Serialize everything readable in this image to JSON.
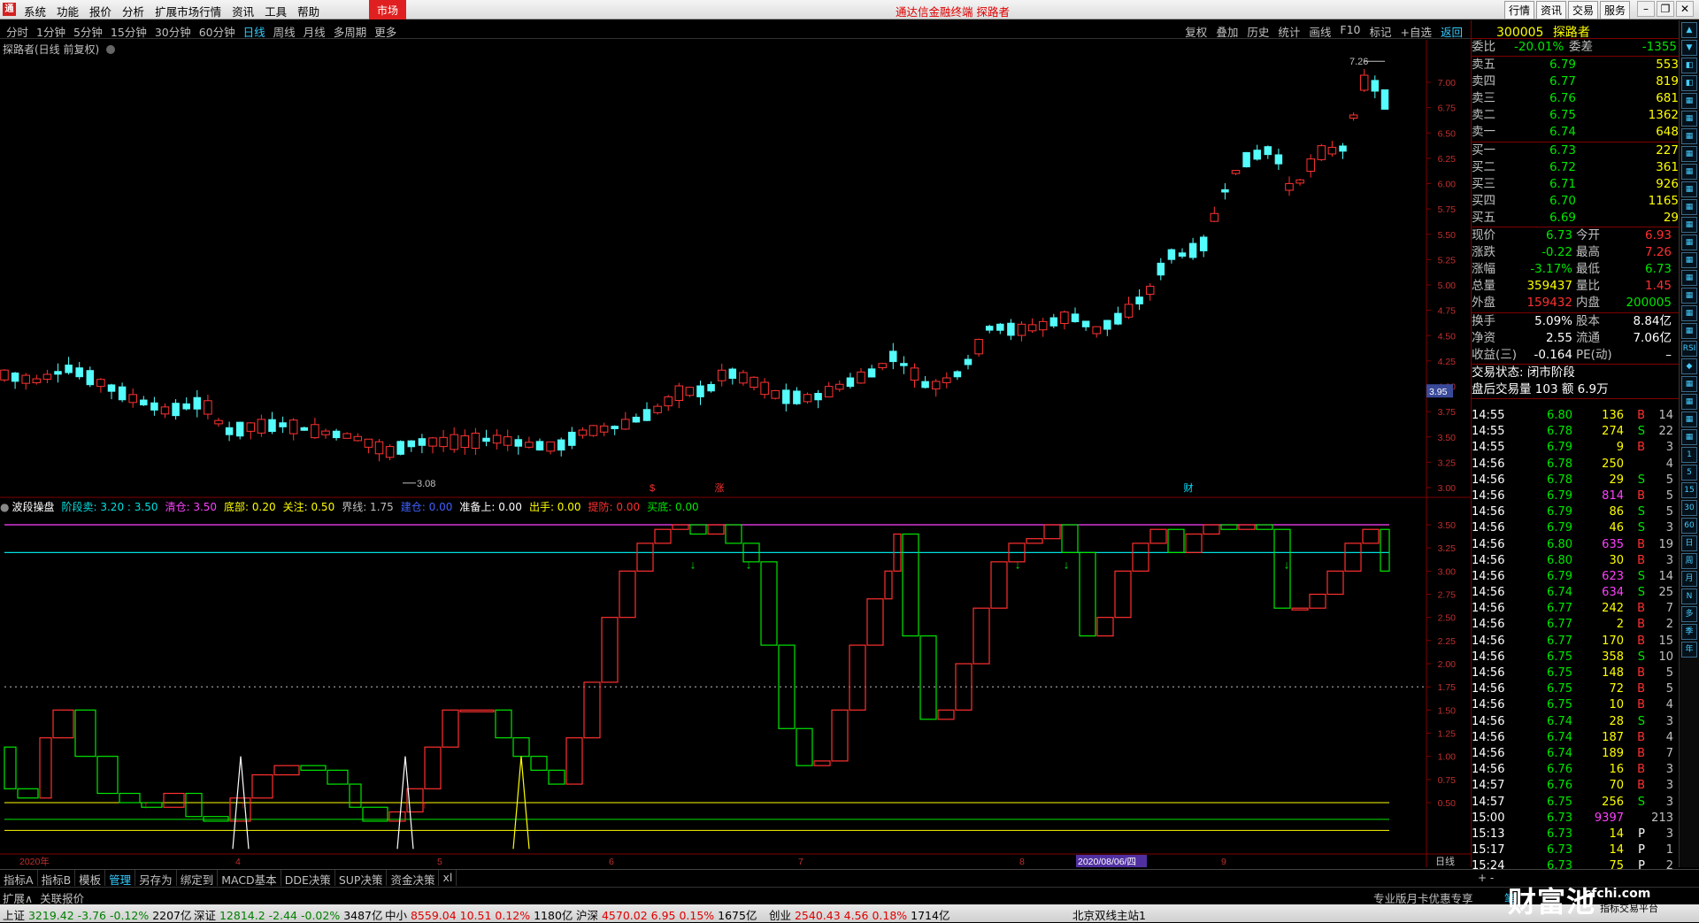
{
  "menubar": {
    "logo": "通",
    "menus": [
      "系统",
      "功能",
      "报价",
      "分析",
      "扩展市场行情",
      "资讯",
      "工具",
      "帮助"
    ],
    "market_button": "市场",
    "title": "通达信金融终端 探路者",
    "right_buttons": [
      "行情",
      "资讯",
      "交易",
      "服务"
    ]
  },
  "periods": {
    "items": [
      "分时",
      "1分钟",
      "5分钟",
      "15分钟",
      "30分钟",
      "60分钟",
      "日线",
      "周线",
      "月线",
      "多周期",
      "更多"
    ],
    "active": "日线",
    "right": [
      "复权",
      "叠加",
      "历史",
      "统计",
      "画线",
      "F10",
      "标记",
      "+自选",
      "返回"
    ]
  },
  "chart": {
    "stock_title": "探路者(日线 前复权)",
    "price_axis": [
      "7.00",
      "6.75",
      "6.50",
      "6.25",
      "6.00",
      "5.75",
      "5.50",
      "5.25",
      "5.00",
      "4.75",
      "4.50",
      "4.25",
      "4.00",
      "3.75",
      "3.50",
      "3.25",
      "3.00"
    ],
    "current_price_tag": "3.95",
    "high_label": "7.26",
    "low_label": "3.08",
    "markers": [
      {
        "text": "$",
        "color": "#ff3030"
      },
      {
        "text": "涨",
        "color": "#ff3030"
      },
      {
        "text": "财",
        "color": "#00e0ff"
      }
    ],
    "indicator_axis": [
      "3.50",
      "3.25",
      "3.00",
      "2.75",
      "2.50",
      "2.25",
      "2.00",
      "1.75",
      "1.50",
      "1.25",
      "1.00",
      "0.75",
      "0.50"
    ],
    "date_axis": [
      "2020年",
      "4",
      "5",
      "6",
      "7",
      "8",
      "2020/08/06/四",
      "9"
    ],
    "period_label": "日线"
  },
  "indicator_header": {
    "name": "波段操盘",
    "fields": [
      {
        "label": "阶段卖:",
        "value": "3.20 : 3.50",
        "color": "#00e0e0"
      },
      {
        "label": "清仓:",
        "value": "3.50",
        "color": "#ff40ff"
      },
      {
        "label": "底部:",
        "value": "0.20",
        "color": "#ffff00"
      },
      {
        "label": "关注:",
        "value": "0.50",
        "color": "#ffff00"
      },
      {
        "label": "界线:",
        "value": "1.75",
        "color": "#c0c0c0"
      },
      {
        "label": "建仓:",
        "value": "0.00",
        "color": "#4060ff"
      },
      {
        "label": "准备上:",
        "value": "0.00",
        "color": "#ffffff"
      },
      {
        "label": "出手:",
        "value": "0.00",
        "color": "#ffff00"
      },
      {
        "label": "提防:",
        "value": "0.00",
        "color": "#ff3030"
      },
      {
        "label": "买底:",
        "value": "0.00",
        "color": "#00e600"
      }
    ]
  },
  "quote": {
    "code": "300005",
    "name": "探路者",
    "weibi_label": "委比",
    "weibi": "-20.01%",
    "weicha_label": "委差",
    "weicha": "-1355",
    "sell": [
      {
        "label": "卖五",
        "price": "6.79",
        "vol": "553"
      },
      {
        "label": "卖四",
        "price": "6.77",
        "vol": "819"
      },
      {
        "label": "卖三",
        "price": "6.76",
        "vol": "681"
      },
      {
        "label": "卖二",
        "price": "6.75",
        "vol": "1362"
      },
      {
        "label": "卖一",
        "price": "6.74",
        "vol": "648"
      }
    ],
    "buy": [
      {
        "label": "买一",
        "price": "6.73",
        "vol": "227"
      },
      {
        "label": "买二",
        "price": "6.72",
        "vol": "361"
      },
      {
        "label": "买三",
        "price": "6.71",
        "vol": "926"
      },
      {
        "label": "买四",
        "price": "6.70",
        "vol": "1165"
      },
      {
        "label": "买五",
        "price": "6.69",
        "vol": "29"
      }
    ],
    "stats": [
      {
        "l1": "现价",
        "v1": "6.73",
        "c1": "#00e600",
        "l2": "今开",
        "v2": "6.93",
        "c2": "#ff3030"
      },
      {
        "l1": "涨跌",
        "v1": "-0.22",
        "c1": "#00e600",
        "l2": "最高",
        "v2": "7.26",
        "c2": "#ff3030"
      },
      {
        "l1": "涨幅",
        "v1": "-3.17%",
        "c1": "#00e600",
        "l2": "最低",
        "v2": "6.73",
        "c2": "#00e600"
      },
      {
        "l1": "总量",
        "v1": "359437",
        "c1": "#ffff00",
        "l2": "量比",
        "v2": "1.45",
        "c2": "#ff3030"
      },
      {
        "l1": "外盘",
        "v1": "159432",
        "c1": "#ff3030",
        "l2": "内盘",
        "v2": "200005",
        "c2": "#00e600"
      }
    ],
    "stats2": [
      {
        "l1": "换手",
        "v1": "5.09%",
        "c1": "#ffffff",
        "l2": "股本",
        "v2": "8.84亿",
        "c2": "#ffffff"
      },
      {
        "l1": "净资",
        "v1": "2.55",
        "c1": "#ffffff",
        "l2": "流通",
        "v2": "7.06亿",
        "c2": "#ffffff"
      },
      {
        "l1": "收益(三)",
        "v1": "-0.164",
        "c1": "#ffffff",
        "l2": "PE(动)",
        "v2": "–",
        "c2": "#ffffff"
      }
    ],
    "trade_status": "交易状态: 闭市阶段",
    "after_hours": "盘后交易量 103 额 6.9万"
  },
  "ticks": [
    {
      "t": "14:55",
      "p": "6.80",
      "v": "136",
      "bs": "B",
      "n": "14",
      "pc": "#00e600",
      "vc": "#ffff00"
    },
    {
      "t": "14:55",
      "p": "6.78",
      "v": "274",
      "bs": "S",
      "n": "22",
      "pc": "#00e600",
      "vc": "#ffff00"
    },
    {
      "t": "14:55",
      "p": "6.79",
      "v": "9",
      "bs": "B",
      "n": "3",
      "pc": "#00e600",
      "vc": "#ffff00"
    },
    {
      "t": "14:56",
      "p": "6.78",
      "v": "250",
      "bs": "",
      "n": "4",
      "pc": "#00e600",
      "vc": "#ffff00"
    },
    {
      "t": "14:56",
      "p": "6.78",
      "v": "29",
      "bs": "S",
      "n": "5",
      "pc": "#00e600",
      "vc": "#ffff00"
    },
    {
      "t": "14:56",
      "p": "6.79",
      "v": "814",
      "bs": "B",
      "n": "5",
      "pc": "#00e600",
      "vc": "#ff40ff"
    },
    {
      "t": "14:56",
      "p": "6.79",
      "v": "86",
      "bs": "S",
      "n": "5",
      "pc": "#00e600",
      "vc": "#ffff00"
    },
    {
      "t": "14:56",
      "p": "6.79",
      "v": "46",
      "bs": "S",
      "n": "3",
      "pc": "#00e600",
      "vc": "#ffff00"
    },
    {
      "t": "14:56",
      "p": "6.80",
      "v": "635",
      "bs": "B",
      "n": "19",
      "pc": "#00e600",
      "vc": "#ff40ff"
    },
    {
      "t": "14:56",
      "p": "6.80",
      "v": "30",
      "bs": "B",
      "n": "3",
      "pc": "#00e600",
      "vc": "#ffff00"
    },
    {
      "t": "14:56",
      "p": "6.79",
      "v": "623",
      "bs": "S",
      "n": "14",
      "pc": "#00e600",
      "vc": "#ff40ff"
    },
    {
      "t": "14:56",
      "p": "6.74",
      "v": "634",
      "bs": "S",
      "n": "25",
      "pc": "#00e600",
      "vc": "#ff40ff"
    },
    {
      "t": "14:56",
      "p": "6.77",
      "v": "242",
      "bs": "B",
      "n": "7",
      "pc": "#00e600",
      "vc": "#ffff00"
    },
    {
      "t": "14:56",
      "p": "6.77",
      "v": "2",
      "bs": "B",
      "n": "2",
      "pc": "#00e600",
      "vc": "#ffff00"
    },
    {
      "t": "14:56",
      "p": "6.77",
      "v": "170",
      "bs": "B",
      "n": "15",
      "pc": "#00e600",
      "vc": "#ffff00"
    },
    {
      "t": "14:56",
      "p": "6.75",
      "v": "358",
      "bs": "S",
      "n": "10",
      "pc": "#00e600",
      "vc": "#ffff00"
    },
    {
      "t": "14:56",
      "p": "6.75",
      "v": "148",
      "bs": "B",
      "n": "5",
      "pc": "#00e600",
      "vc": "#ffff00"
    },
    {
      "t": "14:56",
      "p": "6.75",
      "v": "72",
      "bs": "B",
      "n": "5",
      "pc": "#00e600",
      "vc": "#ffff00"
    },
    {
      "t": "14:56",
      "p": "6.75",
      "v": "10",
      "bs": "B",
      "n": "4",
      "pc": "#00e600",
      "vc": "#ffff00"
    },
    {
      "t": "14:56",
      "p": "6.74",
      "v": "28",
      "bs": "S",
      "n": "3",
      "pc": "#00e600",
      "vc": "#ffff00"
    },
    {
      "t": "14:56",
      "p": "6.74",
      "v": "187",
      "bs": "B",
      "n": "4",
      "pc": "#00e600",
      "vc": "#ffff00"
    },
    {
      "t": "14:56",
      "p": "6.74",
      "v": "189",
      "bs": "B",
      "n": "7",
      "pc": "#00e600",
      "vc": "#ffff00"
    },
    {
      "t": "14:56",
      "p": "6.76",
      "v": "16",
      "bs": "B",
      "n": "3",
      "pc": "#00e600",
      "vc": "#ffff00"
    },
    {
      "t": "14:57",
      "p": "6.76",
      "v": "70",
      "bs": "B",
      "n": "3",
      "pc": "#00e600",
      "vc": "#ffff00"
    },
    {
      "t": "14:57",
      "p": "6.75",
      "v": "256",
      "bs": "S",
      "n": "3",
      "pc": "#00e600",
      "vc": "#ffff00"
    },
    {
      "t": "15:00",
      "p": "6.73",
      "v": "9397",
      "bs": "",
      "n": "213",
      "pc": "#00e600",
      "vc": "#ff40ff"
    },
    {
      "t": "15:13",
      "p": "6.73",
      "v": "14",
      "bs": "P",
      "n": "3",
      "pc": "#00e600",
      "vc": "#ffff00"
    },
    {
      "t": "15:17",
      "p": "6.73",
      "v": "14",
      "bs": "P",
      "n": "1",
      "pc": "#00e600",
      "vc": "#ffff00"
    },
    {
      "t": "15:24",
      "p": "6.73",
      "v": "75",
      "bs": "P",
      "n": "2",
      "pc": "#00e600",
      "vc": "#ffff00"
    }
  ],
  "side_icons": [
    "▲",
    "▼",
    "◧",
    "◧",
    "▦",
    "▦",
    "▦",
    "▦",
    "▦",
    "▦",
    "▦",
    "▦",
    "▦",
    "▦",
    "▦",
    "▦",
    "▦",
    "▦",
    "RSI",
    "◆",
    "▦",
    "▦",
    "▦",
    "▦",
    "1",
    "5",
    "15",
    "30",
    "60",
    "日",
    "周",
    "月",
    "N",
    "多",
    "季",
    "年"
  ],
  "bottom_tabs": [
    "指标A",
    "指标B",
    "模板",
    "管理",
    "另存为",
    "绑定到",
    "MACD基本",
    "DDE决策",
    "SUP决策",
    "资金决策",
    "xl"
  ],
  "bottom_tabs_active": "管理",
  "bottom_right": "+  -",
  "bottom2_left": [
    "扩展∧",
    "关联报价"
  ],
  "bottom2_promo": "专业版月卡优惠专享",
  "bottom2_mode": "笔",
  "status_indices": [
    {
      "name": "上证",
      "price": "3219.42",
      "chg": "-3.76",
      "pct": "-0.12%",
      "amt": "2207亿"
    },
    {
      "name": "深证",
      "price": "12814.2",
      "chg": "-2.44",
      "pct": "-0.02%",
      "amt": "3487亿"
    },
    {
      "name": "中小",
      "price": "8559.04",
      "chg": "10.51",
      "pct": "0.12%",
      "amt": "1180亿"
    },
    {
      "name": "沪深",
      "price": "4570.02",
      "chg": "6.95",
      "pct": "0.15%",
      "amt": "1675亿"
    },
    {
      "name": "创业",
      "price": "2540.43",
      "chg": "4.56",
      "pct": "0.18%",
      "amt": "1714亿"
    }
  ],
  "server": "北京双线主站1",
  "brand": "财富池",
  "brand_site": "cfchi.com",
  "brand_sub": "指标交易平台"
}
